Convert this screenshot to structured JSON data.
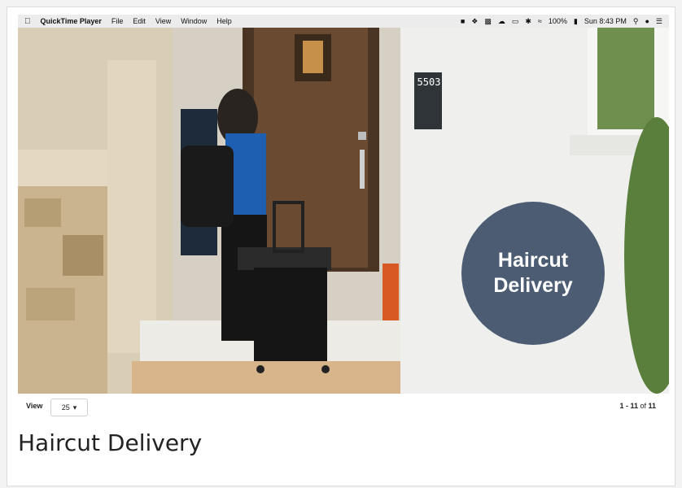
{
  "menubar": {
    "apple_icon": "apple-logo-icon",
    "app_name": "QuickTime Player",
    "menus": [
      "File",
      "Edit",
      "View",
      "Window",
      "Help"
    ],
    "battery": "100%",
    "clock": "Sun 8:43 PM"
  },
  "video": {
    "overlay_line1": "Haircut",
    "overlay_line2": "Delivery",
    "badge_color": "#4b5c73",
    "house_number": "5503"
  },
  "controls": {
    "view_label": "View",
    "per_page": "25",
    "pager_range": "1 - 11",
    "pager_of": " of ",
    "pager_total": "11"
  },
  "caption": "Haircut Delivery"
}
